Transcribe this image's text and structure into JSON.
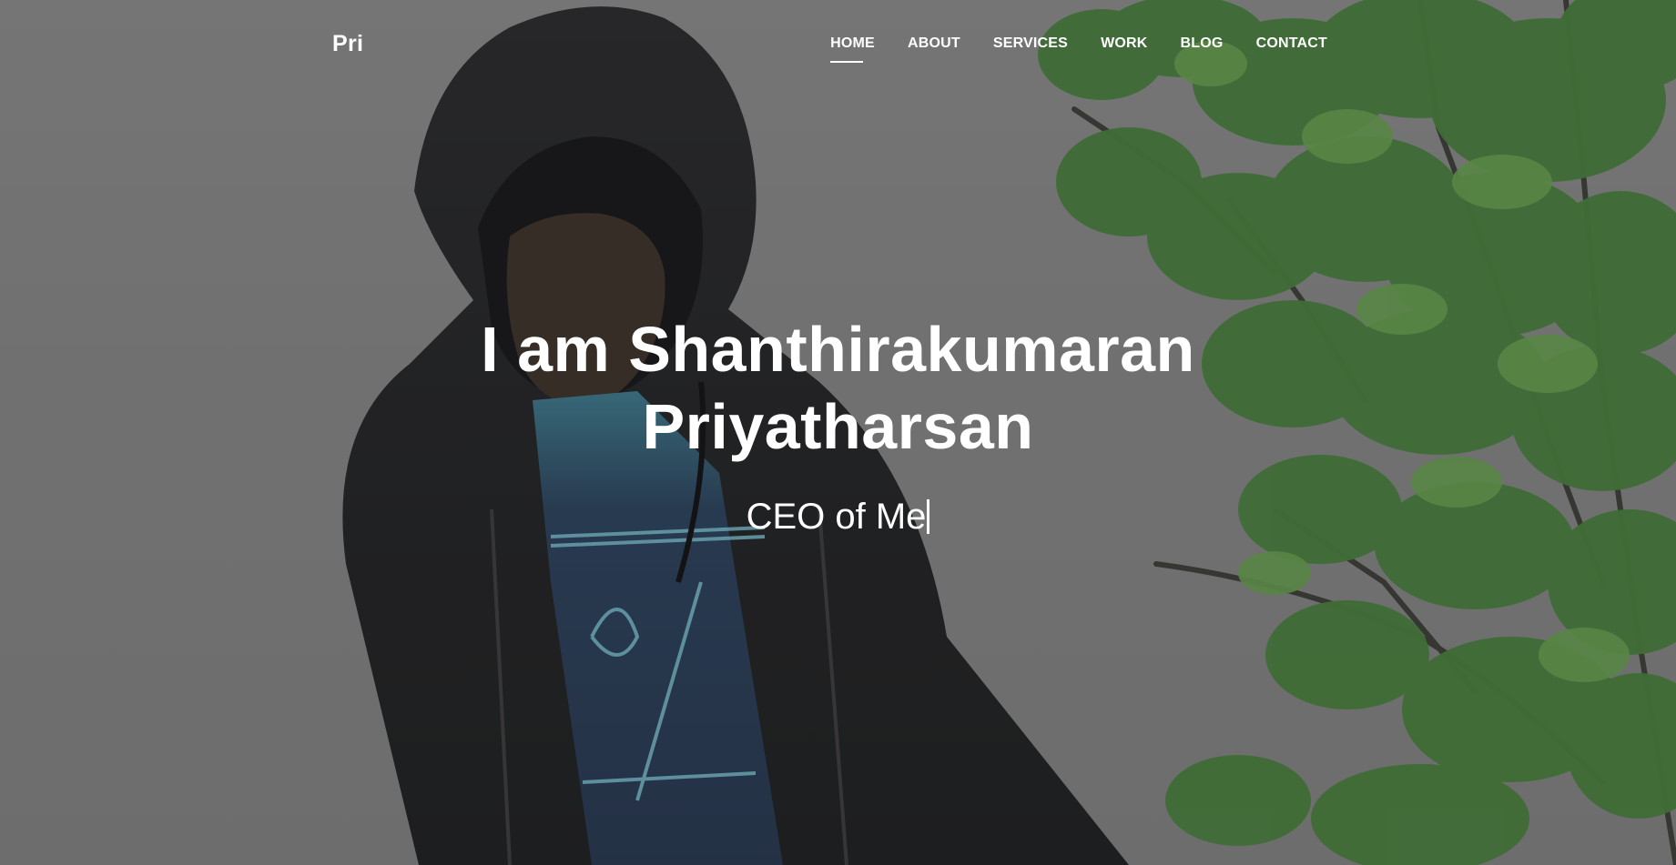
{
  "brand": {
    "label": "Pri"
  },
  "nav": {
    "items": [
      {
        "label": "HOME",
        "active": true
      },
      {
        "label": "ABOUT",
        "active": false
      },
      {
        "label": "SERVICES",
        "active": false
      },
      {
        "label": "WORK",
        "active": false
      },
      {
        "label": "BLOG",
        "active": false
      },
      {
        "label": "CONTACT",
        "active": false
      }
    ]
  },
  "hero": {
    "title": "I am Shanthirakumaran Priyatharsan",
    "subtitle": "CEO of Me",
    "background": "photo of a person in a dark hooded jacket with a tree on the right, under a grey overlay"
  },
  "colors": {
    "overlay": "#7a7a7a",
    "text": "#ffffff",
    "hoodie": "#232427",
    "shirt": "#2d3b4f",
    "leaf": "#3d6b2f"
  }
}
